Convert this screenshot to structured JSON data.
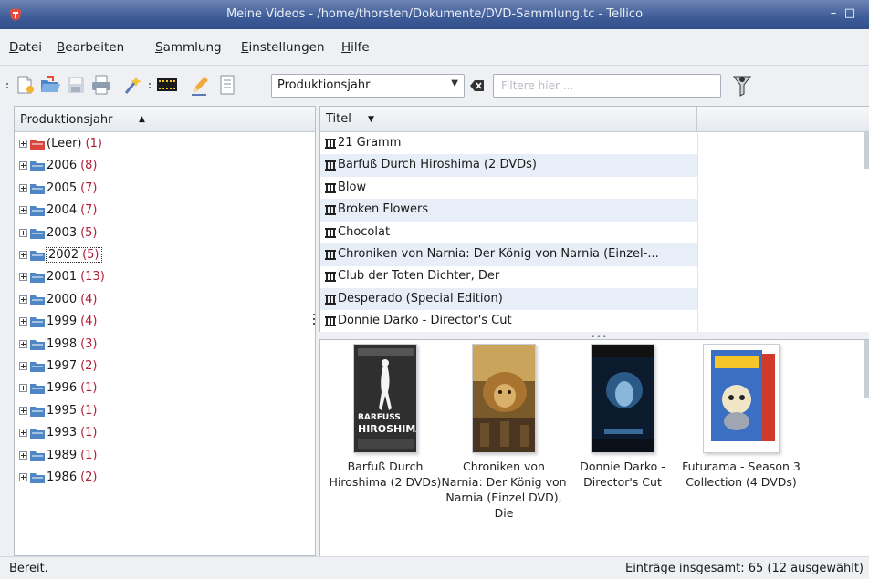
{
  "window": {
    "title": "Meine Videos - /home/thorsten/Dokumente/DVD-Sammlung.tc - Tellico",
    "controls": [
      "minimize",
      "maximize"
    ]
  },
  "menu": {
    "items": [
      {
        "label": "Datei",
        "underline": "D"
      },
      {
        "label": "Bearbeiten",
        "underline": "B"
      },
      {
        "label": "Sammlung",
        "underline": "S"
      },
      {
        "label": "Einstellungen",
        "underline": "E"
      },
      {
        "label": "Hilfe",
        "underline": "H"
      }
    ]
  },
  "toolbar": {
    "icons": [
      "new-icon",
      "open-icon",
      "save-icon",
      "print-icon",
      "wizard-icon",
      "film-icon",
      "edit-entry-icon",
      "report-icon"
    ],
    "group_by": "Produktionsjahr",
    "filter_placeholder": "Filtere hier ..."
  },
  "group_tree": {
    "header": "Produktionsjahr",
    "selected": "2002",
    "groups": [
      {
        "label": "(Leer)",
        "count": "(1)",
        "expand": "plus",
        "empty": true
      },
      {
        "label": "2006",
        "count": "(8)",
        "expand": "plus"
      },
      {
        "label": "2005",
        "count": "(7)",
        "expand": "plus"
      },
      {
        "label": "2004",
        "count": "(7)",
        "expand": "plus"
      },
      {
        "label": "2003",
        "count": "(5)",
        "expand": "plus"
      },
      {
        "label": "2002",
        "count": "(5)",
        "expand": "plus"
      },
      {
        "label": "2001",
        "count": "(13)",
        "expand": "plus"
      },
      {
        "label": "2000",
        "count": "(4)",
        "expand": "plus"
      },
      {
        "label": "1999",
        "count": "(4)",
        "expand": "plus"
      },
      {
        "label": "1998",
        "count": "(3)",
        "expand": "plus"
      },
      {
        "label": "1997",
        "count": "(2)",
        "expand": "plus"
      },
      {
        "label": "1996",
        "count": "(1)",
        "expand": "plus"
      },
      {
        "label": "1995",
        "count": "(1)",
        "expand": "plus"
      },
      {
        "label": "1993",
        "count": "(1)",
        "expand": "plus"
      },
      {
        "label": "1989",
        "count": "(1)",
        "expand": "plus"
      },
      {
        "label": "1986",
        "count": "(2)",
        "expand": "plus"
      }
    ]
  },
  "entry_list": {
    "header": "Titel",
    "rows": [
      "21 Gramm",
      "Barfuß Durch Hiroshima (2 DVDs)",
      "Blow",
      "Broken Flowers",
      "Chocolat",
      "Chroniken von Narnia: Der König von Narnia (Einzel-...",
      "Club der Toten Dichter, Der",
      "Desperado (Special Edition)",
      "Donnie Darko - Director's Cut"
    ]
  },
  "icon_view": {
    "items": [
      {
        "caption": "Barfuß Durch Hiroshima (2 DVDs)",
        "cover_text": "BARFUSS HIROSHIMA"
      },
      {
        "caption": "Chroniken von Narnia: Der König von Narnia (Einzel DVD), Die",
        "cover_text": ""
      },
      {
        "caption": "Donnie Darko - Director's Cut",
        "cover_text": ""
      },
      {
        "caption": "Futurama - Season 3 Collection (4 DVDs)",
        "cover_text": ""
      }
    ]
  },
  "status": {
    "left": "Bereit.",
    "right": "Einträge insgesamt: 65 (12 ausgewählt)"
  },
  "colors": {
    "titlebar": "#3d5b97",
    "count_text": "#b0203a",
    "row_alt": "#e8eef7",
    "folder": "#4f86c6",
    "empty_folder": "#d9453b"
  }
}
